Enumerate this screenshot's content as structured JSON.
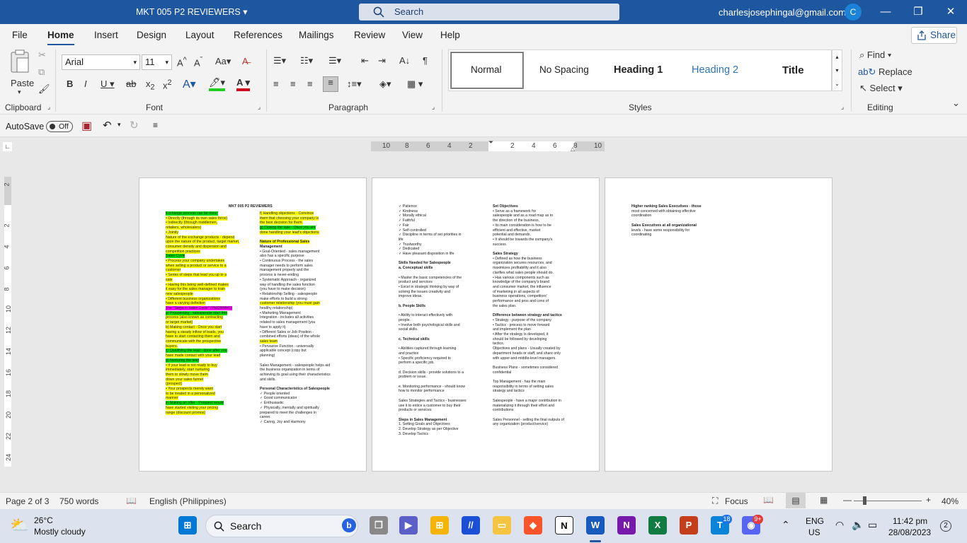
{
  "window": {
    "title": "MKT 005 P2 REVIEWERS",
    "search_placeholder": "Search",
    "account_email": "charlesjosephingal@gmail.com",
    "avatar_initial": "C"
  },
  "menu": {
    "tabs": [
      "File",
      "Home",
      "Insert",
      "Design",
      "Layout",
      "References",
      "Mailings",
      "Review",
      "View",
      "Help"
    ],
    "active": "Home",
    "share": "Share"
  },
  "ribbon": {
    "clipboard": {
      "label": "Clipboard",
      "paste": "Paste"
    },
    "font": {
      "label": "Font",
      "family": "Arial",
      "size": "11"
    },
    "paragraph": {
      "label": "Paragraph"
    },
    "styles": {
      "label": "Styles",
      "items": [
        "Normal",
        "No Spacing",
        "Heading 1",
        "Heading 2",
        "Title"
      ]
    },
    "editing": {
      "label": "Editing",
      "find": "Find",
      "replace": "Replace",
      "select": "Select"
    }
  },
  "qat": {
    "autosave": "AutoSave",
    "autosave_state": "Off"
  },
  "ruler": {
    "labels": [
      "10",
      "8",
      "6",
      "4",
      "2",
      "2",
      "4",
      "6",
      "8",
      "10"
    ]
  },
  "vruler": {
    "labels": [
      "2",
      "2",
      "4",
      "6",
      "8",
      "10",
      "12",
      "14",
      "16",
      "18",
      "20",
      "22",
      "24"
    ]
  },
  "status": {
    "page": "Page 2 of 3",
    "words": "750 words",
    "language": "English (Philippines)",
    "focus": "Focus",
    "zoom": "40%"
  },
  "taskbar": {
    "weather_temp": "26°C",
    "weather_desc": "Mostly cloudy",
    "search": "Search",
    "lang1": "ENG",
    "lang2": "US",
    "time": "11:42 pm",
    "date": "28/08/2023",
    "badge_teams": "18",
    "badge_discord": "9+",
    "notif_count": "2"
  },
  "colors": {
    "titlebar": "#1e56a0",
    "highlight_yellow": "#ffff00",
    "highlight_green": "#00e000",
    "highlight_pink": "#ff00ff"
  },
  "page1": {
    "title": "MKT 005 P2 REVIEWERS",
    "col1": [
      "Exchange process can be done:",
      "• Directly (through its own sales force)",
      "• Indirectly (through middlemen,",
      "  retailers, wholesalers)",
      "• Jointly",
      "Nature of the exchange products - depend",
      "upon the nature of the product, target market,",
      "consumer density and dispersion and",
      "competition practices",
      "Sales Cycle",
      "• Process your company undertakes",
      "  when selling a product or service to a",
      "  customer",
      "• Series of steps that lead you up to a",
      "  sale",
      "• Having this being well-defined makes",
      "  it easy for the sales manager to train",
      "  new salespeople",
      "• Different business organizations",
      "  have a varying definition",
      "The \"Steps in Sales Cycle\" (PMQNMHC)",
      "a) Prospecting - salespeople start this",
      "   process (also known as contracting",
      "   or target market)",
      "b) Making contact - Once you start",
      "   having a steady inflow of leads, you",
      "   have to start contacting them and",
      "   communicate with the prospective",
      "   buyers.",
      "c) Qualifying the lead - done after you",
      "   have made contact with your lead",
      "d) Nurturing the lead",
      "   • If your lead is not ready to buy",
      "     immediately, start nurturing",
      "     them to slowly move them",
      "     down your sales funnel",
      "     (prospect)",
      "   • Your prospects merely want",
      "     to be treated in a personalized",
      "     manner",
      "e) Making an offer - Prospect would",
      "   have started visiting your pricing",
      "   range (discount promos)"
    ],
    "col2": [
      "f) Handling objections - Convince",
      "   them that choosing your company is",
      "   the best decision for them.",
      "g) Closing the sale - Once you are",
      "   done handling your lead's objections",
      "",
      "Nature of Professional Sales",
      "Management",
      "• Goal-Oriented - sales management",
      "  also has a specific purpose",
      "• Continuous Process - the sales",
      "  manager needs to perform sales",
      "  management properly and the",
      "  process is never-ending",
      "• Systematic Approach - organized",
      "  way of handling the sales function",
      "  (you have to make decision)",
      "• Relationship Selling - salespeople",
      "  make efforts to build a strong",
      "  customer relationship (you must gain",
      "  healthy relationship)",
      "• Marketing Management",
      "  Integration - includes all activities",
      "  related to sales management (you",
      "  have to apply it)",
      "• Different Sales or Job Position -",
      "  combined efforts (ideas) of the whole",
      "  sales team",
      "• Pervasive Function - universally",
      "  applicable concept (copy but",
      "  planning)",
      "",
      "Sales Management - salespeople helps aid",
      "the business organization in terms of",
      "achieving its goal using their characteristics",
      "and skills.",
      "",
      "Personal Characteristics of Salespeople",
      "✓ People oriented",
      "✓ Good communicator",
      "✓ Enthusiastic",
      "✓ Physically, mentally and spiritually",
      "  prepared to meet the challenges in",
      "  career.",
      "✓ Caring, Joy and Harmony"
    ]
  },
  "page2": {
    "col1": [
      "✓ Patience",
      "✓ Kindness",
      "✓ Morally ethical",
      "✓ Faithful",
      "✓ Fair",
      "✓ Self-controlled",
      "✓ Discipline in terms of set priorities in",
      "  life",
      "✓ Trustworthy",
      "✓ Dedicated",
      "✓ Have pleasant disposition in life",
      "",
      "Skills Needed for Salespeople",
      "a. Conceptual skills",
      "",
      "  • Master the basic competencies of the",
      "    product and services",
      "  • Excel in strategic thinking by way of",
      "    solving the issues creativity and",
      "    improve ideas.",
      "",
      "b. People Skills",
      "",
      "  • Ability to interact effectively with",
      "    people.",
      "  • Involve both psychological skills and",
      "    social skills.",
      "",
      "c. Technical skills",
      "",
      "  • Abilities captured through learning",
      "    and practice",
      "  • Specific proficiency required to",
      "    perform a specific job.",
      "",
      "d. Decision skills - provide solutions to a",
      "problem or issue.",
      "",
      "e. Monitoring performance - should know",
      "how to monitor performance",
      "",
      "Sales Strategies and Tactics - businesses",
      "use it to entice a customer to buy their",
      "products or services",
      "",
      "Steps in Sales Management",
      "  1. Setting Goals and Objectives",
      "  2. Develop Strategy as per Objective",
      "  3. Develop Tactics"
    ],
    "col2": [
      "Set Objectives",
      "  • Serve as a framework for",
      "    salespeople and as a road map as to",
      "    the direction of the business.",
      "  • Its main consideration is how to be",
      "    efficient and effective, market",
      "    potential and demands.",
      "  • It should be towards the company's",
      "    success.",
      "",
      "Sales Strategy",
      "  • Defined as how the business",
      "    organization secures resources, and",
      "    maximizes profitability and it also",
      "    clarifies what sales people should do.",
      "  • Has various components such as",
      "    knowledge of the company's brand",
      "    and consumer market, the influence",
      "    of marketing in all aspects of",
      "    business operations, competitors'",
      "    performance and pros and cons of",
      "    the sales plan.",
      "",
      "Difference between strategy and tactics",
      "  • Strategy - purpose of the company",
      "  • Tactics - process to move forward",
      "    and implement the plan",
      "  • After the strategy is developed, it",
      "    should be followed by developing",
      "    tactics.",
      "Objectives and plans - Usually created by",
      "department heads or staff, and share only",
      "with upper-and-middle-level managers.",
      "",
      "Business Plans - sometimes considered",
      "confidential",
      "",
      "Top Management - has the main",
      "responsibility in terms of setting sales",
      "strategy and tactics",
      "",
      "Salespeople - have a major contribution in",
      "materializing it through their effort and",
      "contributions",
      "",
      "Sales Personnel - selling the final outputs of",
      "any organization (product/service)"
    ]
  },
  "page3": {
    "col1": [
      "Higher ranking Sales Executives - those",
      "most concerned with obtaining effective",
      "coordination",
      "",
      "Sales Executives at all organizational",
      "levels - have some responsibility for",
      "coordinating"
    ]
  }
}
